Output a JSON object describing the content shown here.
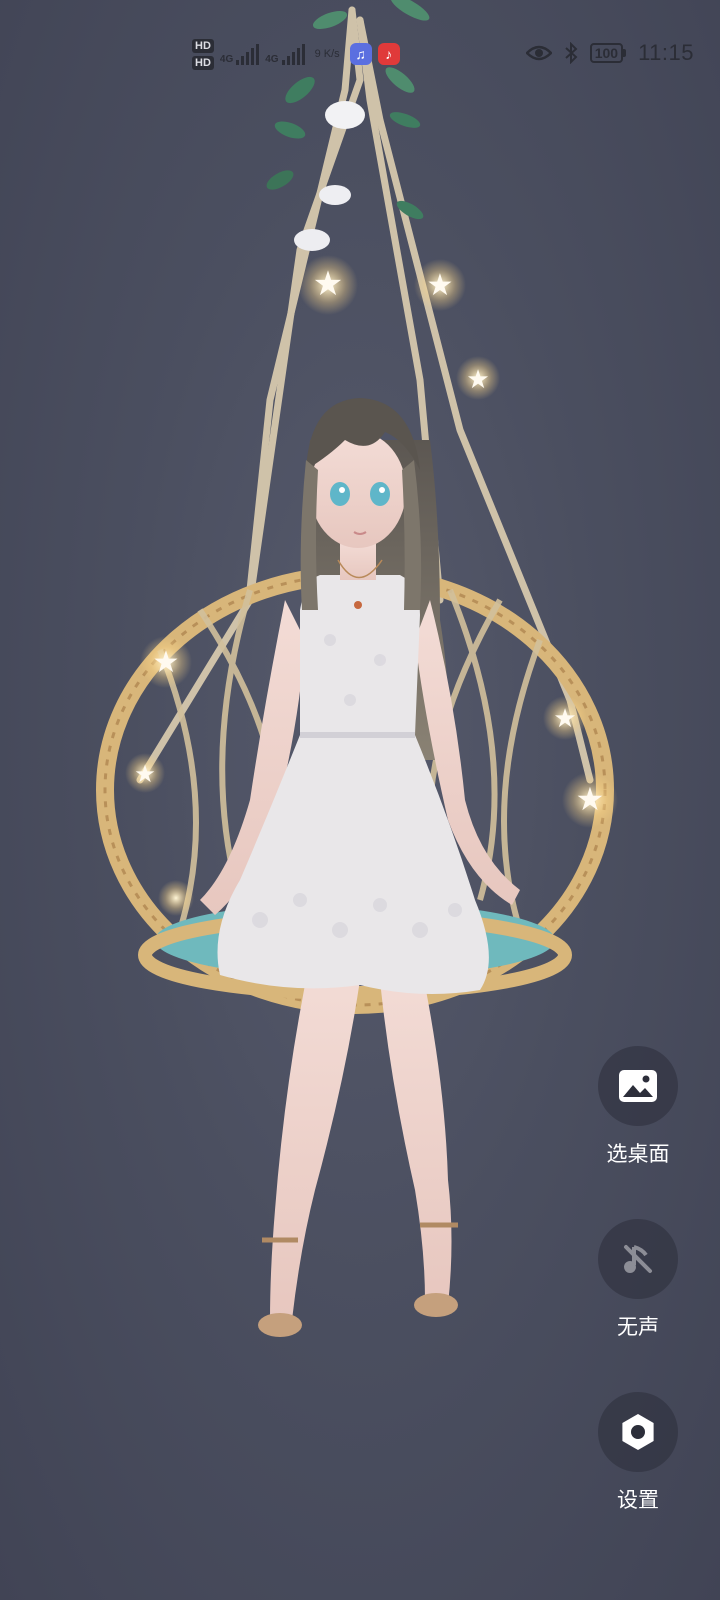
{
  "status_bar": {
    "hd_badges": [
      "HD",
      "HD"
    ],
    "network_labels": [
      "4G",
      "4G"
    ],
    "net_speed": "9 K/s",
    "battery": "100",
    "time": "11:15"
  },
  "actions": {
    "choose_wallpaper": "选桌面",
    "mute": "无声",
    "settings": "设置"
  },
  "colors": {
    "background": "#4b4f60",
    "button_bg": "#2c2e3a",
    "music_app": "#5b6fe0",
    "netease_app": "#e03a3a"
  }
}
